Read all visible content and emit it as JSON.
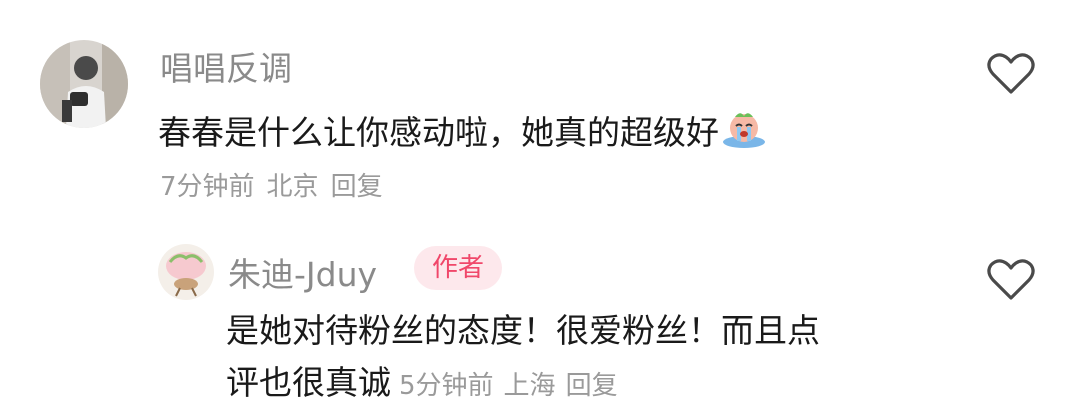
{
  "comments": [
    {
      "username": "唱唱反调",
      "text": "春春是什么让你感动啦，她真的超级好",
      "emoji": "crying-face-emoji",
      "time": "7分钟前",
      "location": "北京",
      "reply_label": "回复",
      "like_icon": "heart-outline-icon"
    },
    {
      "username": "朱迪-Jduy",
      "badge": "作者",
      "text_line1": "是她对待粉丝的态度！很爱粉丝！而且点",
      "text_line2": "评也很真诚",
      "time": "5分钟前",
      "location": "上海",
      "reply_label": "回复",
      "like_icon": "heart-outline-icon"
    }
  ],
  "colors": {
    "username": "#8a8a8a",
    "text": "#1a1a1a",
    "meta": "#9a9a9a",
    "badge_bg": "#fde8ec",
    "badge_text": "#f0476a"
  }
}
